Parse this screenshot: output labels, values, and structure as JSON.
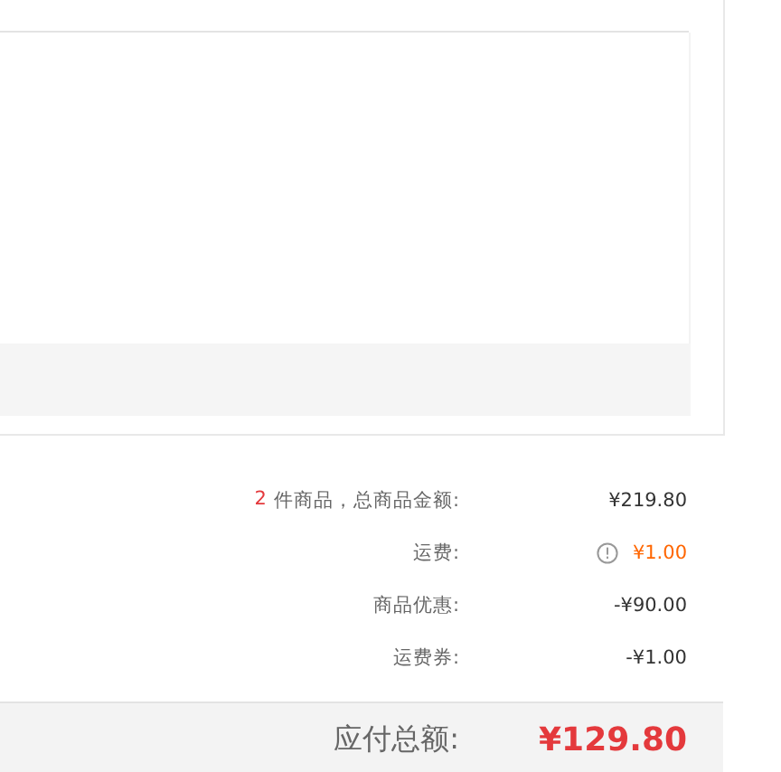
{
  "summary": {
    "item_count": "2",
    "rows": [
      {
        "kind": "count",
        "label": "件商品，总商品金额:",
        "value": "¥219.80"
      },
      {
        "kind": "shipping",
        "label": "运费:",
        "value": "¥1.00"
      },
      {
        "kind": "plain",
        "label": "商品优惠:",
        "value": "-¥90.00"
      },
      {
        "kind": "plain",
        "label": "运费券:",
        "value": "-¥1.00"
      }
    ]
  },
  "total": {
    "label": "应付总额:",
    "value": "¥129.80"
  }
}
